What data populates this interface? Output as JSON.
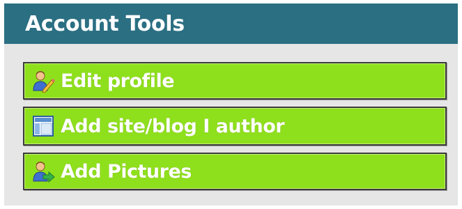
{
  "panel": {
    "title": "Account Tools"
  },
  "buttons": [
    {
      "label": "Edit profile",
      "icon": "user-edit-icon"
    },
    {
      "label": "Add site/blog I author",
      "icon": "layout-icon"
    },
    {
      "label": "Add Pictures",
      "icon": "user-add-icon"
    }
  ],
  "colors": {
    "header_bg": "#2b6f82",
    "panel_bg": "#e6e6e6",
    "button_bg": "#8fe01c",
    "text": "#ffffff"
  }
}
